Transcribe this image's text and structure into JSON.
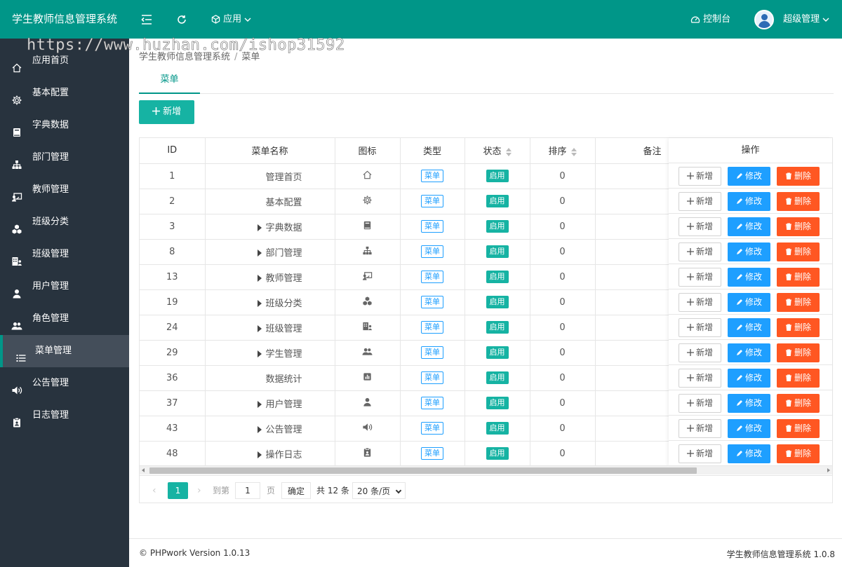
{
  "header": {
    "brand": "学生教师信息管理系统",
    "app_menu": "应用",
    "console": "控制台",
    "user": "超级管理"
  },
  "watermark": "https://www.huzhan.com/ishop31592",
  "sidebar": {
    "items": [
      {
        "label": "应用首页",
        "icon": "home-icon"
      },
      {
        "label": "基本配置",
        "icon": "gear-icon"
      },
      {
        "label": "字典数据",
        "icon": "book-icon"
      },
      {
        "label": "部门管理",
        "icon": "sitemap-icon"
      },
      {
        "label": "教师管理",
        "icon": "teacher-icon"
      },
      {
        "label": "班级分类",
        "icon": "cubes-icon"
      },
      {
        "label": "班级管理",
        "icon": "building-user-icon"
      },
      {
        "label": "用户管理",
        "icon": "user-icon"
      },
      {
        "label": "角色管理",
        "icon": "users-icon"
      },
      {
        "label": "菜单管理",
        "icon": "list-icon"
      },
      {
        "label": "公告管理",
        "icon": "speaker-icon"
      },
      {
        "label": "日志管理",
        "icon": "clipboard-icon"
      }
    ]
  },
  "breadcrumb": {
    "root": "学生教师信息管理系统",
    "sep": "/",
    "current": "菜单"
  },
  "tab": "菜单",
  "add_button": "新增",
  "table": {
    "columns": {
      "id": "ID",
      "name": "菜单名称",
      "icon": "图标",
      "type": "类型",
      "status": "状态",
      "sort": "排序",
      "remark": "备注",
      "ops": "操作"
    },
    "rows": [
      {
        "id": "1",
        "name": "管理首页",
        "expandable": false,
        "icon": "home-icon",
        "type": "菜单",
        "status": "启用",
        "sort": "0",
        "remark": ""
      },
      {
        "id": "2",
        "name": "基本配置",
        "expandable": false,
        "icon": "gear-icon",
        "type": "菜单",
        "status": "启用",
        "sort": "0",
        "remark": ""
      },
      {
        "id": "3",
        "name": "字典数据",
        "expandable": true,
        "icon": "book-icon",
        "type": "菜单",
        "status": "启用",
        "sort": "0",
        "remark": ""
      },
      {
        "id": "8",
        "name": "部门管理",
        "expandable": true,
        "icon": "sitemap-icon",
        "type": "菜单",
        "status": "启用",
        "sort": "0",
        "remark": ""
      },
      {
        "id": "13",
        "name": "教师管理",
        "expandable": true,
        "icon": "teacher-icon",
        "type": "菜单",
        "status": "启用",
        "sort": "0",
        "remark": ""
      },
      {
        "id": "19",
        "name": "班级分类",
        "expandable": true,
        "icon": "cubes-icon",
        "type": "菜单",
        "status": "启用",
        "sort": "0",
        "remark": ""
      },
      {
        "id": "24",
        "name": "班级管理",
        "expandable": true,
        "icon": "building-user-icon",
        "type": "菜单",
        "status": "启用",
        "sort": "0",
        "remark": ""
      },
      {
        "id": "29",
        "name": "学生管理",
        "expandable": true,
        "icon": "users-icon",
        "type": "菜单",
        "status": "启用",
        "sort": "0",
        "remark": ""
      },
      {
        "id": "36",
        "name": "数据统计",
        "expandable": false,
        "icon": "chart-icon",
        "type": "菜单",
        "status": "启用",
        "sort": "0",
        "remark": ""
      },
      {
        "id": "37",
        "name": "用户管理",
        "expandable": true,
        "icon": "user-icon",
        "type": "菜单",
        "status": "启用",
        "sort": "0",
        "remark": ""
      },
      {
        "id": "43",
        "name": "公告管理",
        "expandable": true,
        "icon": "speaker-icon",
        "type": "菜单",
        "status": "启用",
        "sort": "0",
        "remark": ""
      },
      {
        "id": "48",
        "name": "操作日志",
        "expandable": true,
        "icon": "clipboard-icon",
        "type": "菜单",
        "status": "启用",
        "sort": "0",
        "remark": ""
      }
    ],
    "ops": {
      "add": "新增",
      "edit": "修改",
      "delete": "删除"
    }
  },
  "pager": {
    "current": "1",
    "goto": "到第",
    "input": "1",
    "page": "页",
    "confirm": "确定",
    "total": "共 12 条",
    "size": "20 条/页"
  },
  "footer": {
    "left": "© PHPwork Version 1.0.13",
    "right": "学生教师信息管理系统 1.0.8"
  },
  "colors": {
    "primary": "#009688",
    "accent": "#16b3a3",
    "blue": "#1e9fff",
    "red": "#ff5722",
    "sidebar": "#28333e"
  }
}
